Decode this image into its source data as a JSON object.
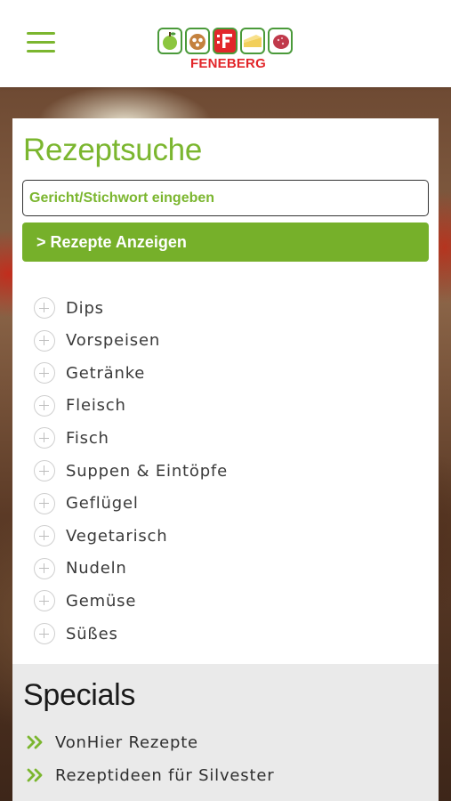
{
  "header": {
    "logo_text": "FENEBERG",
    "menu_icon": "hamburger-menu-icon"
  },
  "search": {
    "title": "Rezeptsuche",
    "placeholder": "Gericht/Stichwort eingeben",
    "button_label": "> Rezepte Anzeigen"
  },
  "categories": [
    {
      "label": "Dips"
    },
    {
      "label": "Vorspeisen"
    },
    {
      "label": "Getränke"
    },
    {
      "label": "Fleisch"
    },
    {
      "label": "Fisch"
    },
    {
      "label": "Suppen & Eintöpfe"
    },
    {
      "label": "Geflügel"
    },
    {
      "label": "Vegetarisch"
    },
    {
      "label": "Nudeln"
    },
    {
      "label": "Gemüse"
    },
    {
      "label": "Süßes"
    }
  ],
  "specials": {
    "title": "Specials",
    "links": [
      {
        "label": "VonHier Rezepte"
      },
      {
        "label": "Rezeptideen für Silvester"
      }
    ]
  },
  "colors": {
    "accent_green": "#7bb62f",
    "button_green": "#76b02a",
    "logo_red": "#e2262a",
    "specials_bg": "#eaeaea"
  }
}
